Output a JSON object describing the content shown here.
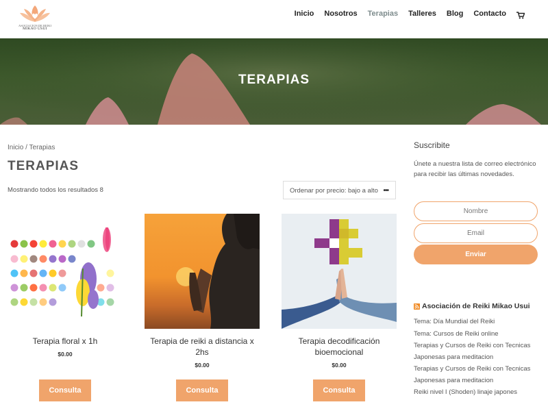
{
  "header": {
    "logo_line1": "ASOCIACION DE REIKI",
    "logo_line2": "MIKAO USUI",
    "nav": [
      "Inicio",
      "Nosotros",
      "Terapias",
      "Talleres",
      "Blog",
      "Contacto"
    ],
    "active": "Terapias",
    "cart_icon": "cart-icon"
  },
  "hero": {
    "title": "TERAPIAS"
  },
  "breadcrumb": {
    "home": "Inicio",
    "separator": " / ",
    "current": "Terapias"
  },
  "page_title": "TERAPIAS",
  "result_count": "Mostrando todos los resultados 8",
  "orderby": {
    "selected": "Ordenar por precio: bajo a alto"
  },
  "products": [
    {
      "name": "Terapia floral x 1h",
      "price": "$0.00",
      "button": "Consulta"
    },
    {
      "name": "Terapia de reiki a distancia x 2hs",
      "price": "$0.00",
      "button": "Consulta"
    },
    {
      "name": "Terapia decodificación bioemocional",
      "price": "$0.00",
      "button": "Consulta"
    }
  ],
  "sidebar": {
    "title": "Suscribite",
    "text": "Únete a nuestra lista de correo electrónico para recibir las últimas novedades.",
    "name_placeholder": "Nombre",
    "email_placeholder": "Email",
    "submit": "Enviar",
    "rss_title": "Asociación de Reiki Mikao Usui",
    "rss_links": [
      "Tema: Día Mundial del Reiki",
      "Tema: Cursos de Reiki online",
      "Terapias y Cursos de Reiki con Tecnicas Japonesas para meditacion",
      "Terapias y Cursos de Reiki con Tecnicas Japonesas para meditacion",
      "Reiki nivel I (Shoden) linaje japones"
    ]
  },
  "colors": {
    "accent": "#f0a46b",
    "nav_active": "#7e8c8d",
    "hero_green": "#3e5a2c"
  }
}
